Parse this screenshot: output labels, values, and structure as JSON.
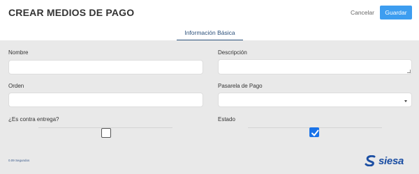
{
  "header": {
    "title": "CREAR MEDIOS DE PAGO",
    "cancel_label": "Cancelar",
    "save_label": "Guardar"
  },
  "tabs": [
    {
      "label": "Información Básica",
      "active": true
    }
  ],
  "form": {
    "nombre": {
      "label": "Nombre",
      "value": ""
    },
    "descripcion": {
      "label": "Descripción",
      "value": ""
    },
    "orden": {
      "label": "Orden",
      "value": ""
    },
    "pasarela": {
      "label": "Pasarela de Pago",
      "value": ""
    },
    "contra_entrega": {
      "label": "¿Es contra entrega?",
      "checked": false
    },
    "estado": {
      "label": "Estado",
      "checked": true
    }
  },
  "footer": {
    "timing": "0.09 Segundos",
    "logo_text": "siesa"
  },
  "colors": {
    "accent": "#3d9df0",
    "tab": "#2a4f7a",
    "checkbox_checked": "#1a73e8",
    "logo": "#1c4fa3"
  }
}
